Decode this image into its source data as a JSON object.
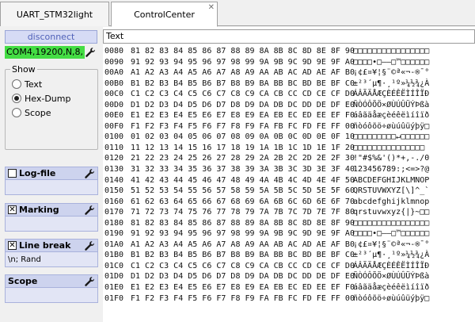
{
  "tabs": [
    {
      "label": "UART_STM32light",
      "active": false
    },
    {
      "label": "ControlCenter",
      "active": true,
      "close_glyph": "✕"
    }
  ],
  "left": {
    "disconnect_label": "disconnect",
    "connection": "COM4,19200,N,8,",
    "show": {
      "legend": "Show",
      "options": [
        {
          "label": "Text",
          "selected": false
        },
        {
          "label": "Hex-Dump",
          "selected": true
        },
        {
          "label": "Scope",
          "selected": false
        }
      ]
    },
    "sections": [
      {
        "title": "Log-file",
        "checkbox": true,
        "checked": false,
        "body": ""
      },
      {
        "title": "Marking",
        "checkbox": true,
        "checked": true,
        "body": ""
      },
      {
        "title": "Line break",
        "checkbox": true,
        "checked": true,
        "body": "\\n; Rand"
      },
      {
        "title": "Scope",
        "checkbox": false,
        "checked": false,
        "body": ""
      }
    ]
  },
  "right": {
    "text_field": "Text",
    "hex_lines": [
      {
        "addr": "0080",
        "bytes": "81 82 83 84 85 86 87 88 89 8A 8B 8C 8D 8E 8F 90",
        "ascii": "□□□□□□□□□□□□□□□□"
      },
      {
        "addr": "0090",
        "bytes": "91 92 93 94 95 96 97 98 99 9A 9B 9C 9D 9E 9F A0",
        "ascii": "□□□□•□–—□™□□□□□□"
      },
      {
        "addr": "00A0",
        "bytes": "A1 A2 A3 A4 A5 A6 A7 A8 A9 AA AB AC AD AE AF B0",
        "ascii": "¡¢£¤¥¦§¨©ª«¬-®¯°"
      },
      {
        "addr": "00B0",
        "bytes": "B1 B2 B3 B4 B5 B6 B7 B8 B9 BA BB BC BD BE BF C0",
        "ascii": "±²³´µ¶·¸¹º»¼½¾¿À"
      },
      {
        "addr": "00C0",
        "bytes": "C1 C2 C3 C4 C5 C6 C7 C8 C9 CA CB CC CD CE CF D0",
        "ascii": "ÁÂÃÄÅÆÇÈÉÊËÌÍÎÏÐ"
      },
      {
        "addr": "00D0",
        "bytes": "D1 D2 D3 D4 D5 D6 D7 D8 D9 DA DB DC DD DE DF E0",
        "ascii": "ÑÒÓÔÕÖ×ØÙÚÛÜÝÞßà"
      },
      {
        "addr": "00E0",
        "bytes": "E1 E2 E3 E4 E5 E6 E7 E8 E9 EA EB EC ED EE EF F0",
        "ascii": "áâãäåæçèéêëìíîïð"
      },
      {
        "addr": "00F0",
        "bytes": "F1 F2 F3 F4 F5 F6 F7 F8 F9 FA FB FC FD FE FF 00",
        "ascii": "ñòóôõö÷øùúûüýþÿ□"
      },
      {
        "addr": "0100",
        "bytes": "01 02 03 04 05 06 07 08 09 0A 0B 0C 0D 0E 0F 10",
        "ascii": "□□□□□□□□□↵□□□□□□"
      },
      {
        "addr": "0110",
        "bytes": "11 12 13 14 15 16 17 18 19 1A 1B 1C 1D 1E 1F 20",
        "ascii": "□□□□□□□□□□□□□□□ "
      },
      {
        "addr": "0120",
        "bytes": "21 22 23 24 25 26 27 28 29 2A 2B 2C 2D 2E 2F 30",
        "ascii": "!\"#$%&'()*+,-./0"
      },
      {
        "addr": "0130",
        "bytes": "31 32 33 34 35 36 37 38 39 3A 3B 3C 3D 3E 3F 40",
        "ascii": "123456789:;<=>?@"
      },
      {
        "addr": "0140",
        "bytes": "41 42 43 44 45 46 47 48 49 4A 4B 4C 4D 4E 4F 50",
        "ascii": "ABCDEFGHIJKLMNOP"
      },
      {
        "addr": "0150",
        "bytes": "51 52 53 54 55 56 57 58 59 5A 5B 5C 5D 5E 5F 60",
        "ascii": "QRSTUVWXYZ[\\]^_`"
      },
      {
        "addr": "0160",
        "bytes": "61 62 63 64 65 66 67 68 69 6A 6B 6C 6D 6E 6F 70",
        "ascii": "abcdefghijklmnop"
      },
      {
        "addr": "0170",
        "bytes": "71 72 73 74 75 76 77 78 79 7A 7B 7C 7D 7E 7F 80",
        "ascii": "qrstuvwxyz{|}~□□"
      },
      {
        "addr": "0180",
        "bytes": "81 82 83 84 85 86 87 88 89 8A 8B 8C 8D 8E 8F 90",
        "ascii": "□□□□□□□□□□□□□□□□"
      },
      {
        "addr": "0190",
        "bytes": "91 92 93 94 95 96 97 98 99 9A 9B 9C 9D 9E 9F A0",
        "ascii": "□□□□•□–—□™□□□□□□"
      },
      {
        "addr": "01A0",
        "bytes": "A1 A2 A3 A4 A5 A6 A7 A8 A9 AA AB AC AD AE AF B0",
        "ascii": "¡¢£¤¥¦§¨©ª«¬-®¯°"
      },
      {
        "addr": "01B0",
        "bytes": "B1 B2 B3 B4 B5 B6 B7 B8 B9 BA BB BC BD BE BF C0",
        "ascii": "±²³´µ¶·¸¹º»¼½¾¿À"
      },
      {
        "addr": "01C0",
        "bytes": "C1 C2 C3 C4 C5 C6 C7 C8 C9 CA CB CC CD CE CF D0",
        "ascii": "ÁÂÃÄÅÆÇÈÉÊËÌÍÎÏÐ"
      },
      {
        "addr": "01D0",
        "bytes": "D1 D2 D3 D4 D5 D6 D7 D8 D9 DA DB DC DD DE DF E0",
        "ascii": "ÑÒÓÔÕÖ×ØÙÚÛÜÝÞßà"
      },
      {
        "addr": "01E0",
        "bytes": "E1 E2 E3 E4 E5 E6 E7 E8 E9 EA EB EC ED EE EF F0",
        "ascii": "áâãäåæçèéêëìíîïð"
      },
      {
        "addr": "01F0",
        "bytes": "F1 F2 F3 F4 F5 F6 F7 F8 F9 FA FB FC FD FE FF 00",
        "ascii": "ñòóôõö÷øùúûüýþÿ□"
      }
    ]
  },
  "colors": {
    "connected": "#44dd44",
    "button_bg": "#d6dbf5",
    "section_header": "#cdd3ee"
  }
}
